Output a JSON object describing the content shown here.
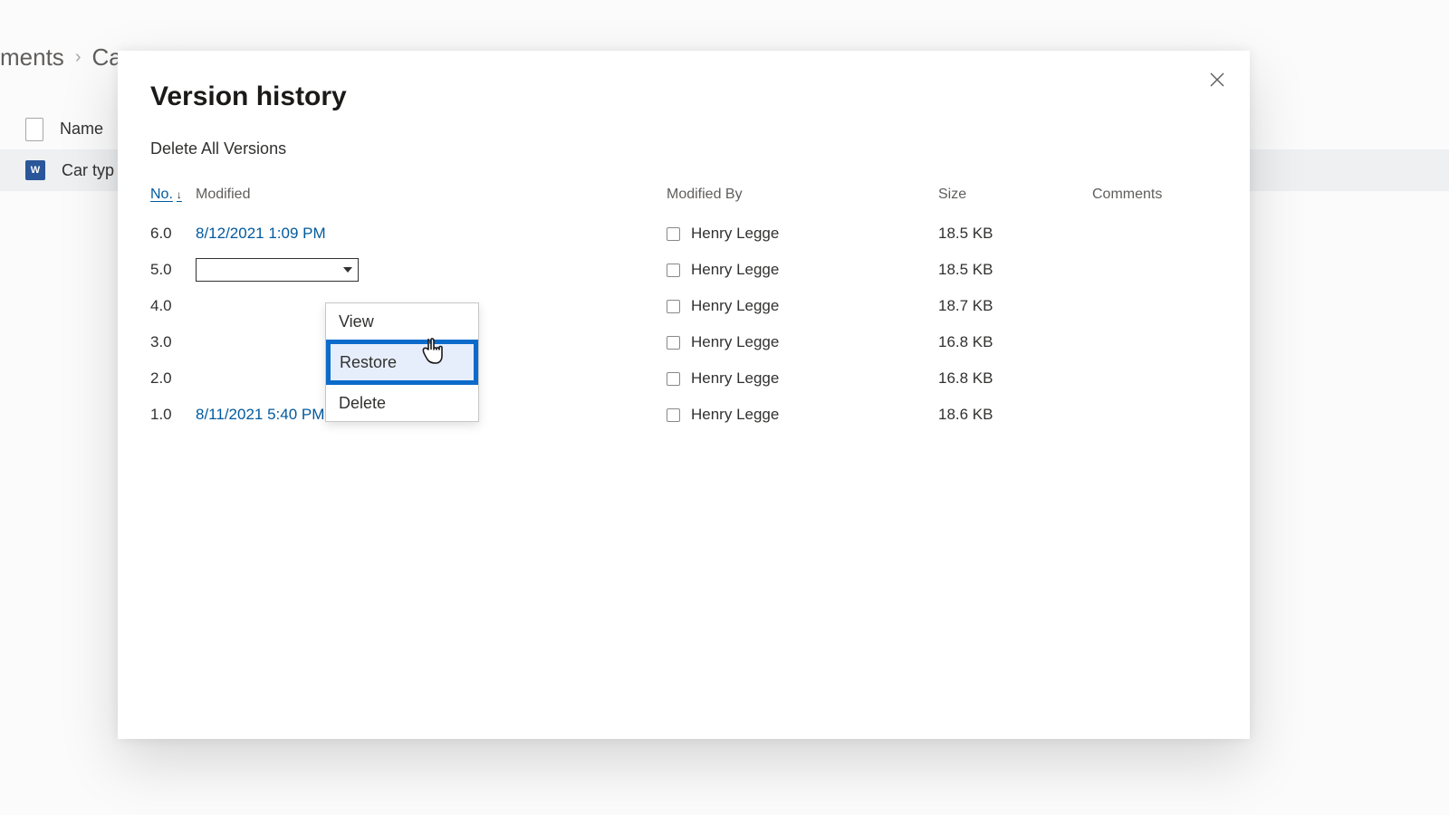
{
  "breadcrumb": {
    "seg1": "ments",
    "seg2": "Ca"
  },
  "listheader": {
    "name_label": "Name"
  },
  "filelist": {
    "item0_name": "Car typ",
    "word_badge": "W"
  },
  "dialog": {
    "title": "Version history",
    "delete_all": "Delete All Versions",
    "columns": {
      "no": "No.",
      "modified": "Modified",
      "modified_by": "Modified By",
      "size": "Size",
      "comments": "Comments"
    },
    "rows": [
      {
        "ver": "6.0",
        "modified": "8/12/2021 1:09 PM",
        "user": "Henry Legge",
        "size": "18.5 KB"
      },
      {
        "ver": "5.0",
        "modified": "",
        "user": "Henry Legge",
        "size": "18.5 KB",
        "dropdown_open": true
      },
      {
        "ver": "4.0",
        "modified": "",
        "user": "Henry Legge",
        "size": "18.7 KB"
      },
      {
        "ver": "3.0",
        "modified": "",
        "user": "Henry Legge",
        "size": "16.8 KB"
      },
      {
        "ver": "2.0",
        "modified": "",
        "user": "Henry Legge",
        "size": "16.8 KB"
      },
      {
        "ver": "1.0",
        "modified": "8/11/2021 5:40 PM",
        "user": "Henry Legge",
        "size": "18.6 KB"
      }
    ],
    "context_menu": {
      "view": "View",
      "restore": "Restore",
      "delete": "Delete"
    }
  }
}
